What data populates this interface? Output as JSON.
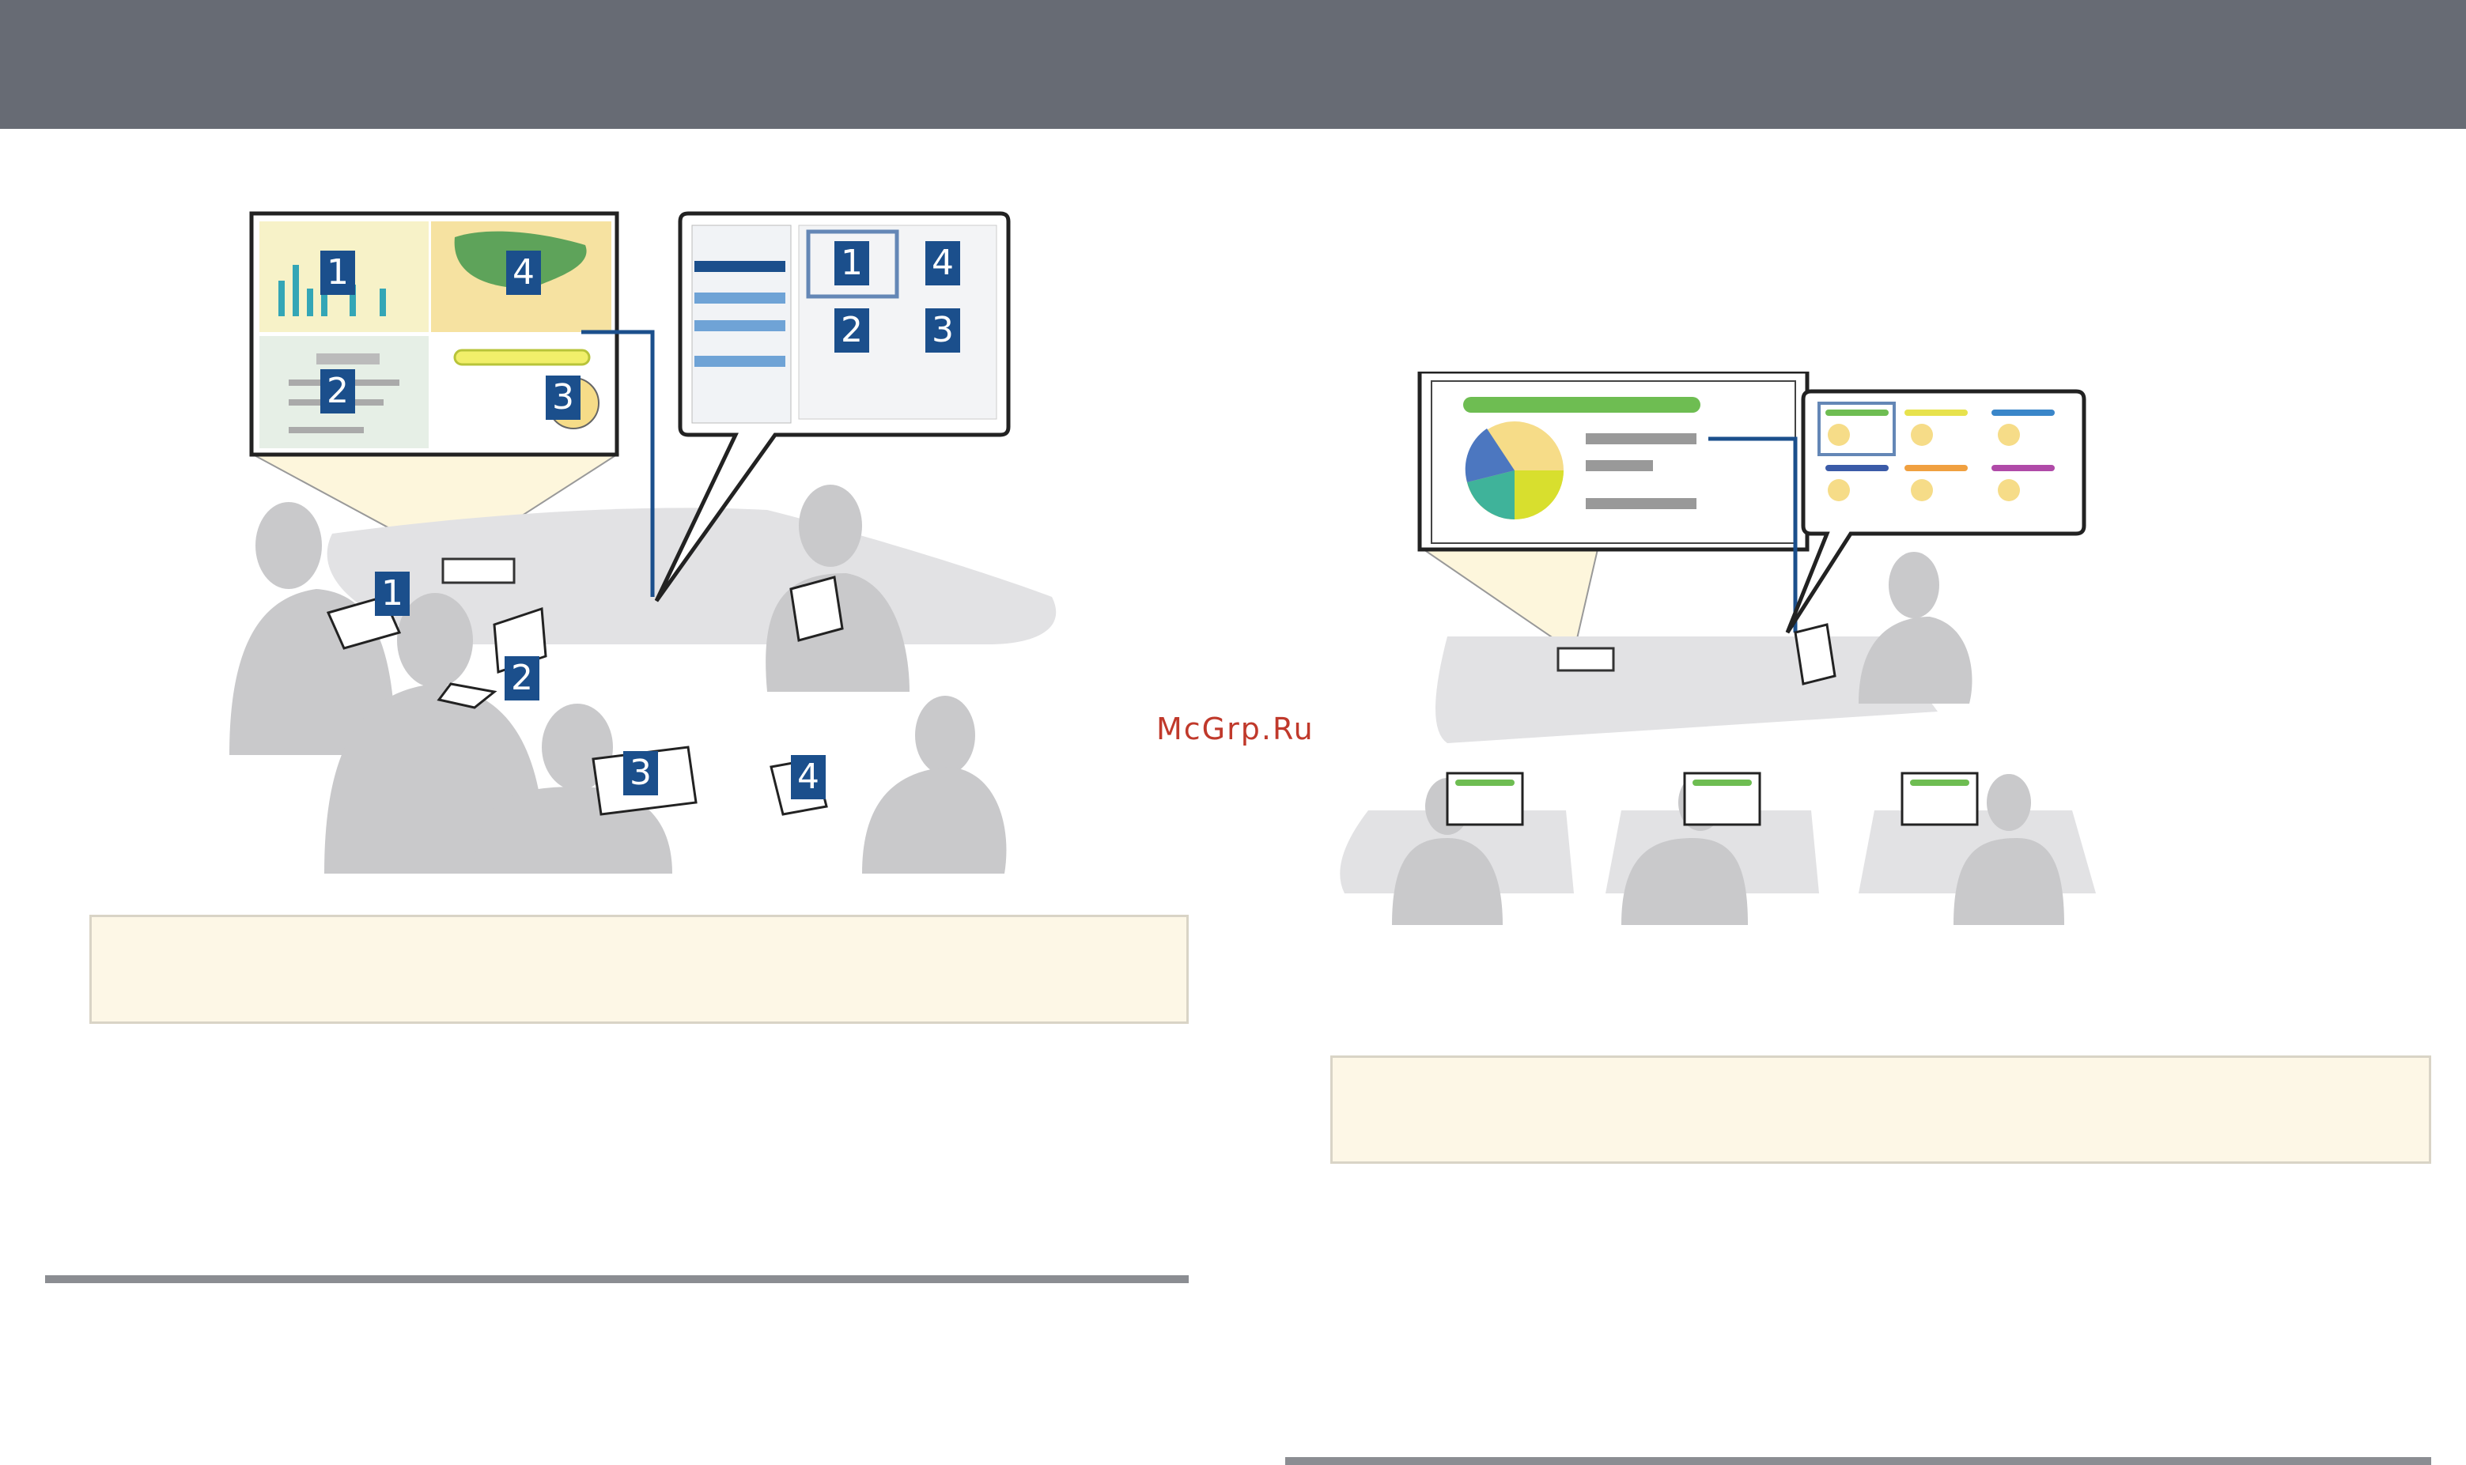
{
  "page": {
    "watermark": "McGrp.Ru"
  },
  "left_figure": {
    "badges": [
      "1",
      "2",
      "3",
      "4"
    ],
    "colors": {
      "badge": "#1b4f8c",
      "panel_1": "#f7f2c8",
      "panel_4": "#f6e2a1",
      "panel_2": "#e6efe6",
      "panel_3": "#ffffff",
      "silhouette": "#c8c8ca",
      "link": "#1b4f8c"
    }
  },
  "right_figure": {
    "colors": {
      "banner_green": "#6ebd52",
      "pie_yellow": "#f6dc88",
      "pie_green": "#3fb39a",
      "pie_lime": "#d8df2e",
      "pie_blue": "#4c77c0",
      "link": "#1b4f8c"
    }
  },
  "note_boxes": [
    {
      "text": ""
    },
    {
      "text": ""
    }
  ],
  "colors": {
    "header": "#676b74",
    "note_bg": "#fdf7e6",
    "rule": "#8b8d92"
  }
}
